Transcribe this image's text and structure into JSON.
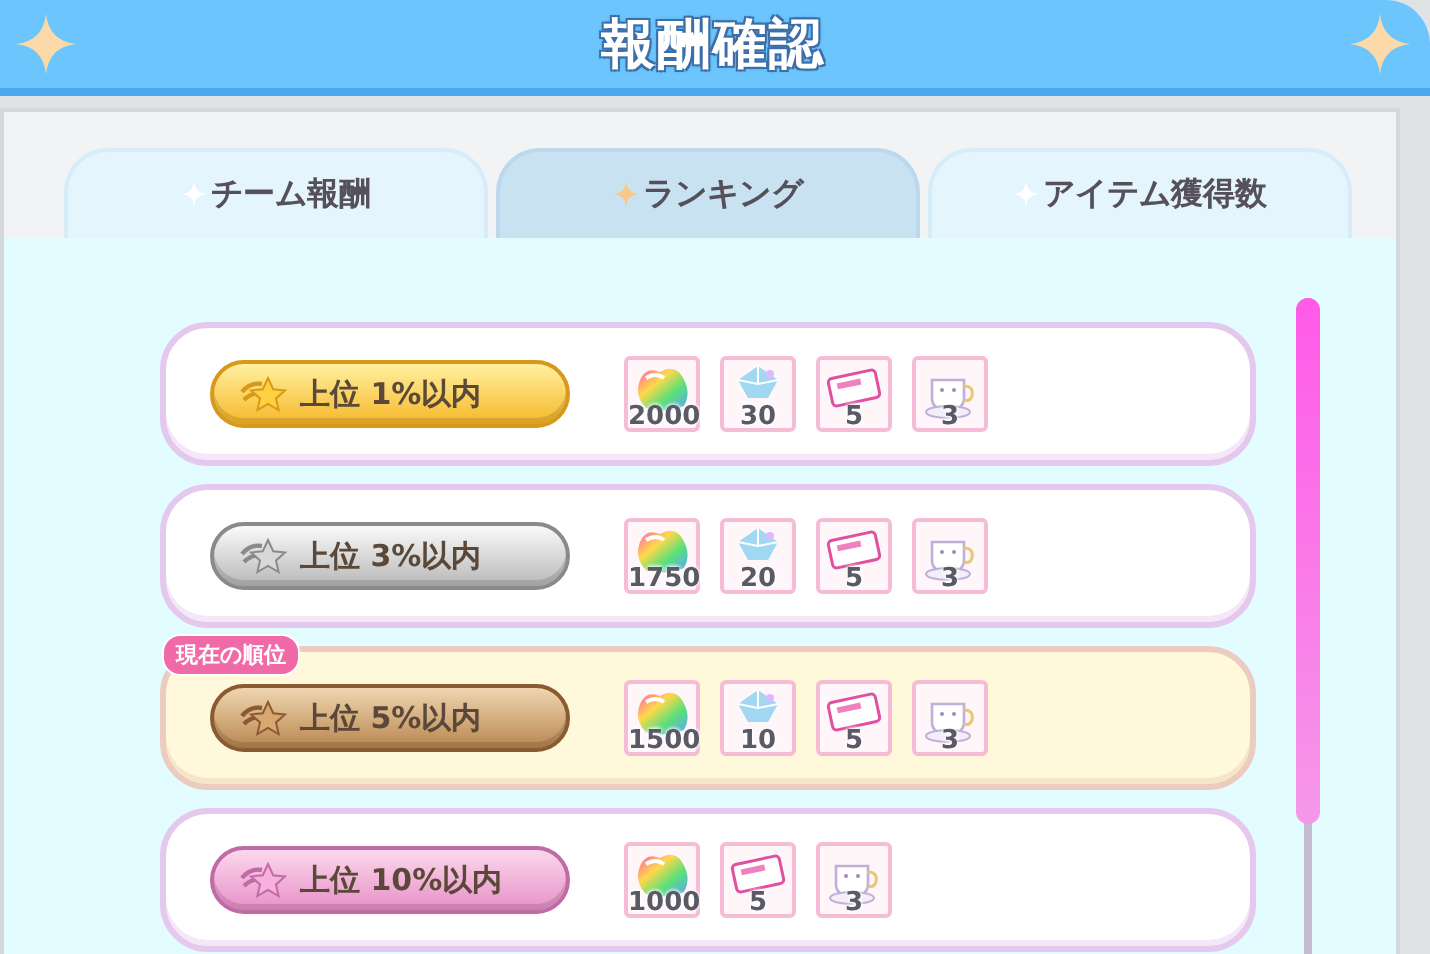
{
  "header": {
    "title": "報酬確認"
  },
  "tabs": [
    {
      "label": "チーム報酬",
      "selected": false
    },
    {
      "label": "ランキング",
      "selected": true
    },
    {
      "label": "アイテム獲得数",
      "selected": false
    }
  ],
  "rows": [
    {
      "rank": "上位 1%以内",
      "kind": "gold",
      "current": false,
      "rewards": [
        {
          "kind": "gem",
          "count": "2000"
        },
        {
          "kind": "crystal",
          "count": "30"
        },
        {
          "kind": "ticket",
          "count": "5"
        },
        {
          "kind": "cup",
          "count": "3"
        }
      ]
    },
    {
      "rank": "上位 3%以内",
      "kind": "silver",
      "current": false,
      "rewards": [
        {
          "kind": "gem",
          "count": "1750"
        },
        {
          "kind": "crystal",
          "count": "20"
        },
        {
          "kind": "ticket",
          "count": "5"
        },
        {
          "kind": "cup",
          "count": "3"
        }
      ]
    },
    {
      "rank": "上位 5%以内",
      "kind": "bronze",
      "current": true,
      "tag": "現在の順位",
      "rewards": [
        {
          "kind": "gem",
          "count": "1500"
        },
        {
          "kind": "crystal",
          "count": "10"
        },
        {
          "kind": "ticket",
          "count": "5"
        },
        {
          "kind": "cup",
          "count": "3"
        }
      ]
    },
    {
      "rank": "上位 10%以内",
      "kind": "pink",
      "current": false,
      "rewards": [
        {
          "kind": "gem",
          "count": "1000"
        },
        {
          "kind": "ticket",
          "count": "5"
        },
        {
          "kind": "cup",
          "count": "3"
        }
      ]
    }
  ]
}
